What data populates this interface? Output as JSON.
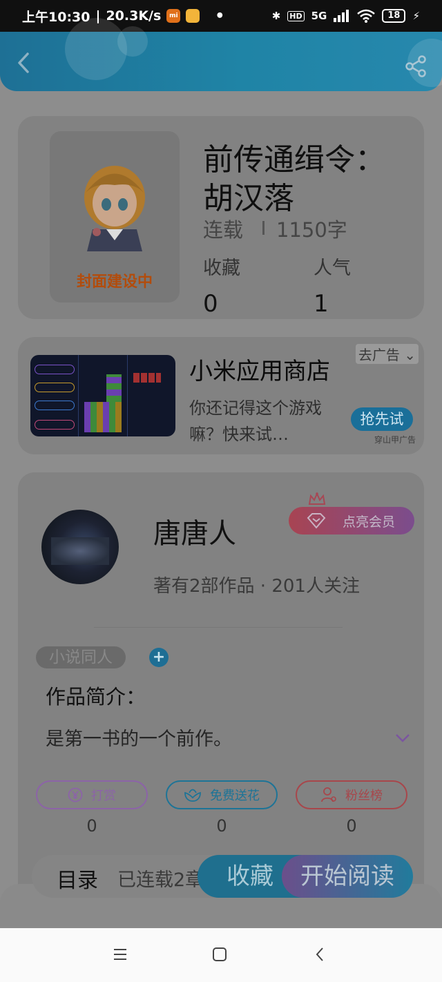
{
  "status_bar": {
    "time": "上午10:30",
    "net_speed": "20.3K/s",
    "network": "5G",
    "battery": "18"
  },
  "header": {
    "back_icon": "chevron-left-icon",
    "share_icon": "share-icon"
  },
  "book": {
    "cover_label": "封面建设中",
    "title": "前传通缉令：胡汉落",
    "status": "连载",
    "word_count": "1150字",
    "stats": [
      {
        "label": "收藏",
        "value": "0"
      },
      {
        "label": "人气",
        "value": "1"
      }
    ]
  },
  "ad": {
    "title": "小米应用商店",
    "description": "你还记得这个游戏嘛？快来试…",
    "close_label": "去广告",
    "cta_label": "抢先试",
    "source": "穿山甲广告"
  },
  "author": {
    "name": "唐唐人",
    "meta": "著有2部作品 · 201人关注",
    "vip_label": "点亮会员"
  },
  "intro": {
    "tag": "小说同人",
    "title": "作品简介：",
    "text": "是第一书的一个前作。"
  },
  "actions": [
    {
      "label": "打赏",
      "count": "0",
      "color": "#8c63a8",
      "icon": "yen-coin-icon"
    },
    {
      "label": "免费送花",
      "count": "0",
      "color": "#1d7497",
      "icon": "flower-icon"
    },
    {
      "label": "粉丝榜",
      "count": "0",
      "color": "#a8464b",
      "icon": "fans-rank-icon"
    }
  ],
  "bottom_bar": {
    "toc_label": "目录",
    "toc_count": "已连载2章",
    "collect_label": "收藏",
    "read_label": "开始阅读"
  },
  "nav_bar": [
    "menu-icon",
    "home-icon",
    "back-icon"
  ]
}
